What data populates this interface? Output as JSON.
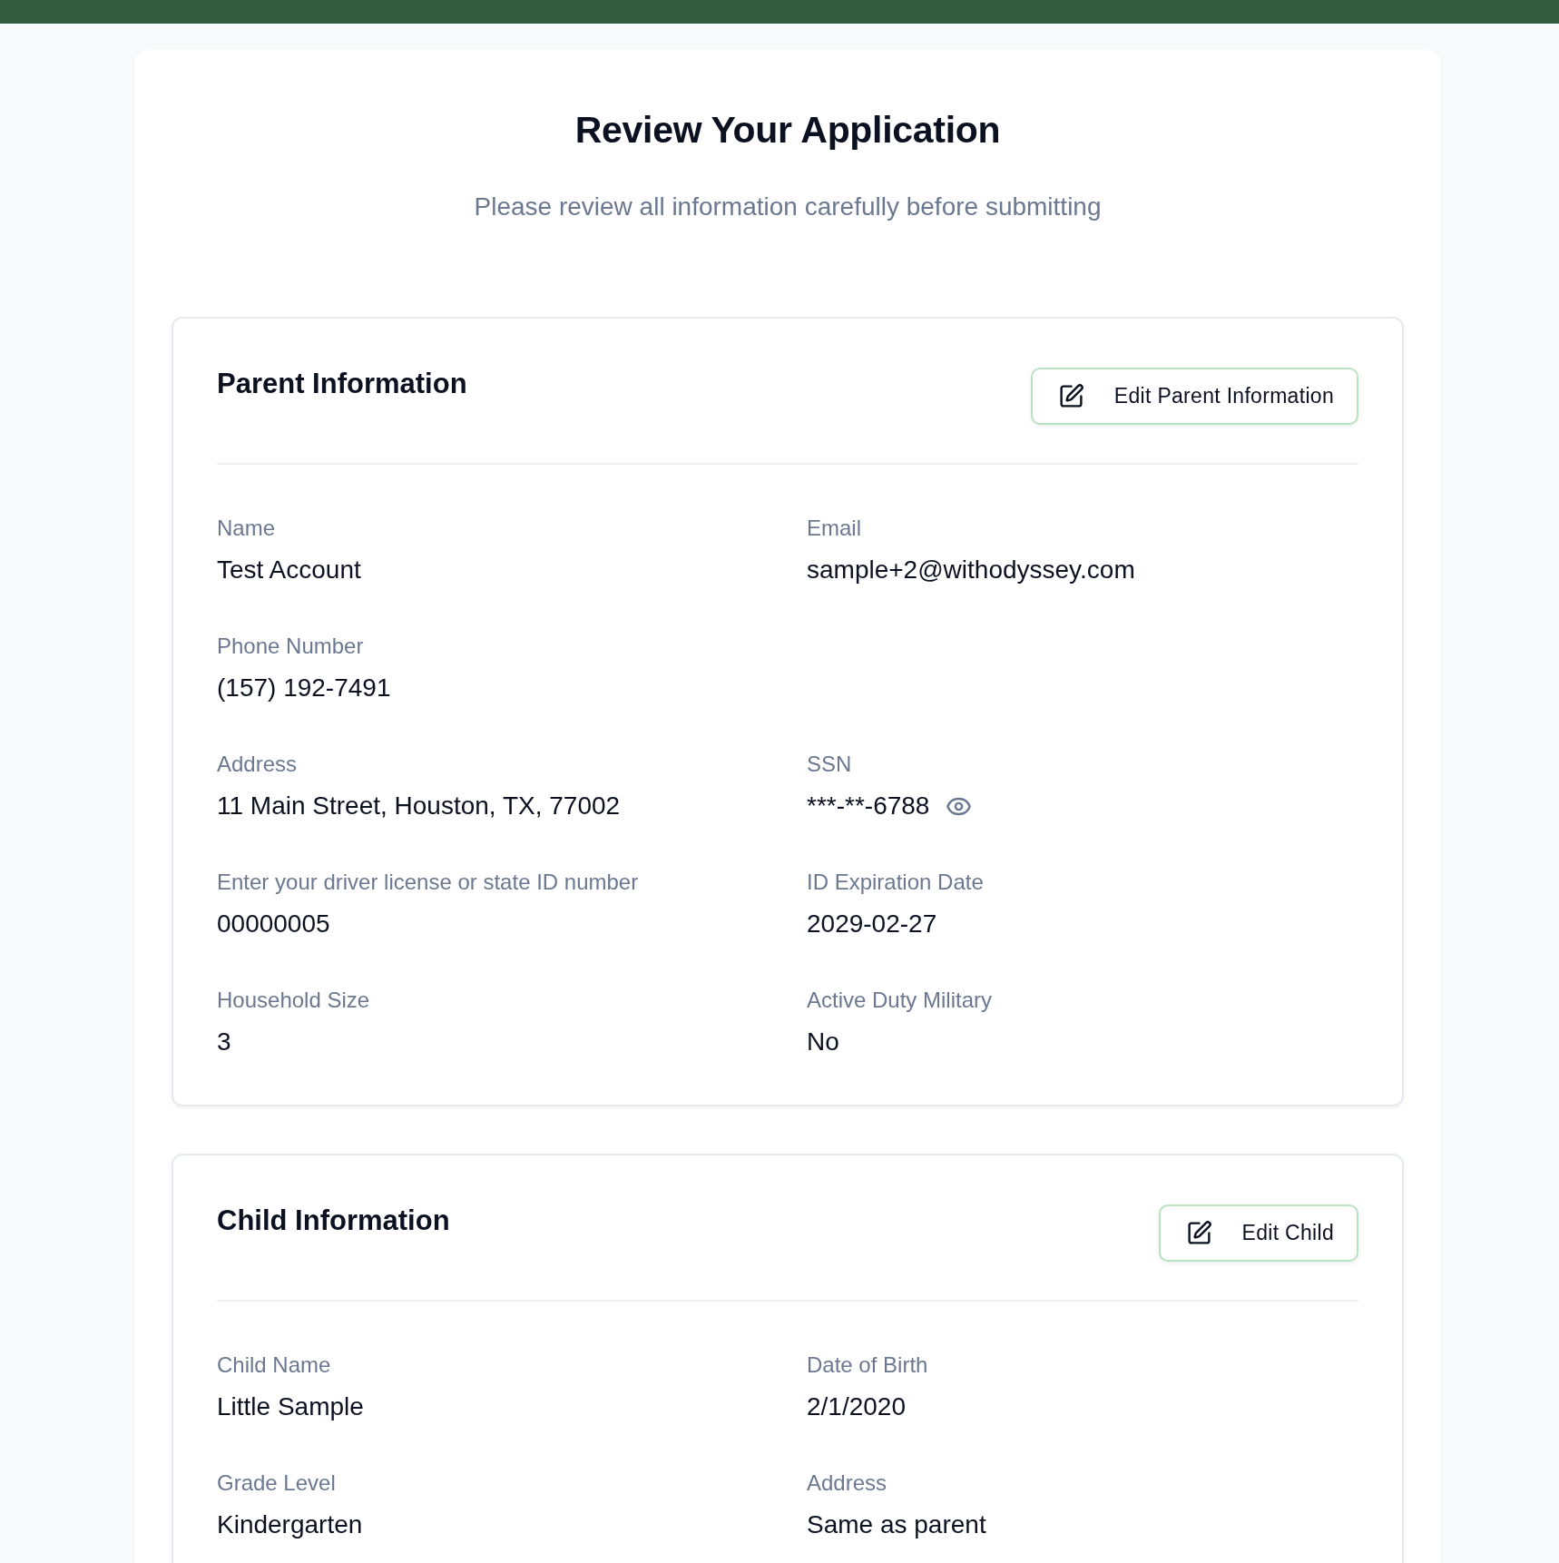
{
  "page": {
    "title": "Review Your Application",
    "subtitle": "Please review all information carefully before submitting"
  },
  "sections": [
    {
      "title": "Parent Information",
      "edit_button": "Edit Parent Information",
      "rows": [
        [
          {
            "kind": "text",
            "label": "Name",
            "value": "Test Account"
          },
          {
            "kind": "text",
            "label": "Email",
            "value": "sample+2@withodyssey.com"
          }
        ],
        [
          {
            "kind": "text",
            "label": "Phone Number",
            "value": "(157) 192-7491"
          }
        ],
        [
          {
            "kind": "text",
            "label": "Address",
            "value": "11 Main Street, Houston, TX, 77002"
          },
          {
            "kind": "masked",
            "label": "SSN",
            "value": "***-**-6788"
          }
        ],
        [
          {
            "kind": "text",
            "label": "Enter your driver license or state ID number",
            "value": "00000005"
          },
          {
            "kind": "text",
            "label": "ID Expiration Date",
            "value": "2029-02-27"
          }
        ],
        [
          {
            "kind": "text",
            "label": "Household Size",
            "value": "3"
          },
          {
            "kind": "text",
            "label": "Active Duty Military",
            "value": "No"
          }
        ]
      ]
    },
    {
      "title": "Child Information",
      "edit_button": "Edit Child",
      "rows": [
        [
          {
            "kind": "text",
            "label": "Child Name",
            "value": "Little Sample"
          },
          {
            "kind": "text",
            "label": "Date of Birth",
            "value": "2/1/2020"
          }
        ],
        [
          {
            "kind": "text",
            "label": "Grade Level",
            "value": "Kindergarten"
          },
          {
            "kind": "text",
            "label": "Address",
            "value": "Same as parent"
          }
        ]
      ]
    }
  ]
}
